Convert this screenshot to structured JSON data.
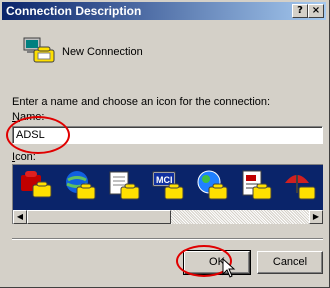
{
  "window": {
    "title": "Connection Description",
    "help_button": "?",
    "close_button": "×"
  },
  "connection": {
    "name_display": "New Connection",
    "icon": "phone-computer-icon"
  },
  "form": {
    "instruction": "Enter a name and choose an icon for the connection:",
    "name_label_underlined": "N",
    "name_label_rest": "ame:",
    "name_value": "ADSL",
    "icon_label_underlined": "I",
    "icon_label_rest": "con:"
  },
  "icon_list": {
    "icons": [
      "phone-red-icon",
      "globe-phone-icon",
      "notebook-phone-icon",
      "mci-phone-icon",
      "globe-circle-phone-icon",
      "document-phone-icon",
      "umbrella-phone-icon"
    ],
    "selected_index": 0,
    "scroll_left": "◀",
    "scroll_right": "▶"
  },
  "buttons": {
    "ok": "OK",
    "cancel": "Cancel"
  },
  "colors": {
    "title_gradient_start": "#0a246a",
    "title_gradient_end": "#a6caf0",
    "annotation": "#e00000",
    "selection": "#0a246a"
  }
}
